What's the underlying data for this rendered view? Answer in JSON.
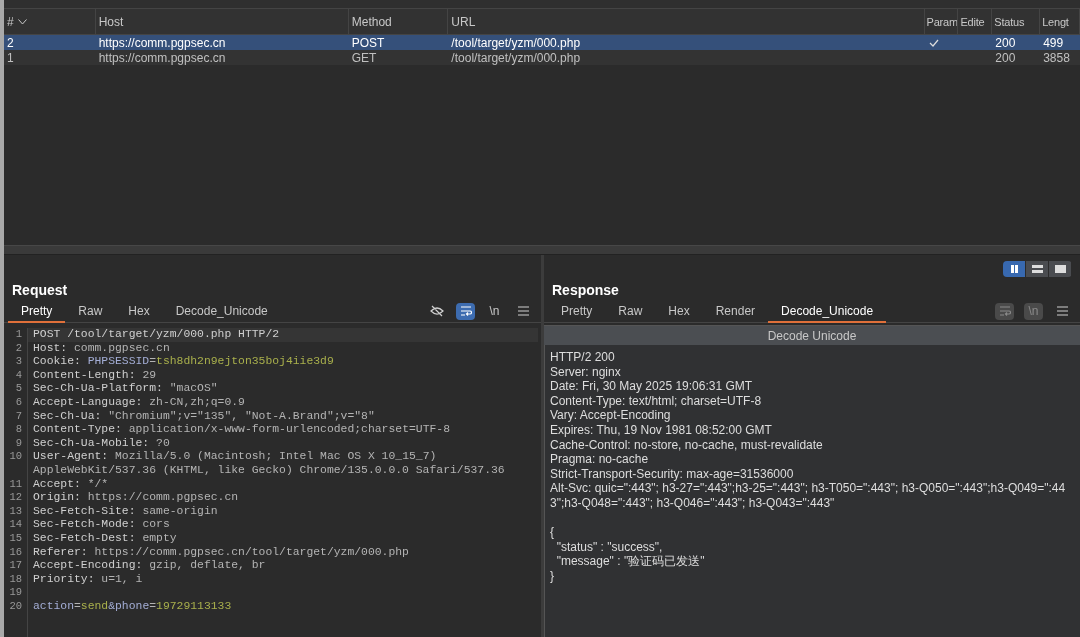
{
  "table": {
    "columns": [
      {
        "label": "#",
        "sorted": true
      },
      {
        "label": "Host",
        "sorted": false
      },
      {
        "label": "Method",
        "sorted": false
      },
      {
        "label": "URL",
        "sorted": false
      },
      {
        "label": "Param",
        "sorted": false
      },
      {
        "label": "Edite",
        "sorted": false
      },
      {
        "label": "Status",
        "sorted": false
      },
      {
        "label": "Lengt",
        "sorted": false
      }
    ],
    "rows": [
      {
        "number": "2",
        "host": "https://comm.pgpsec.cn",
        "method": "POST",
        "url": "/tool/target/yzm/000.php",
        "params": true,
        "status": "200",
        "length": "499",
        "selected": true
      },
      {
        "number": "1",
        "host": "https://comm.pgpsec.cn",
        "method": "GET",
        "url": "/tool/target/yzm/000.php",
        "params": false,
        "status": "200",
        "length": "3858",
        "selected": false
      }
    ]
  },
  "layout_modes": [
    {
      "kind": "columns",
      "selected": true
    },
    {
      "kind": "rows",
      "selected": false
    },
    {
      "kind": "single",
      "selected": false
    }
  ],
  "request": {
    "title": "Request",
    "tabs": [
      {
        "label": "Pretty",
        "selected": true
      },
      {
        "label": "Raw",
        "selected": false
      },
      {
        "label": "Hex",
        "selected": false
      },
      {
        "label": "Decode_Unicode",
        "selected": false
      }
    ],
    "tools": [
      {
        "kind": "hide",
        "on": false,
        "disabled": false
      },
      {
        "kind": "wrap",
        "on": true,
        "disabled": false
      },
      {
        "kind": "newline",
        "label": "\\n",
        "on": false,
        "disabled": false
      },
      {
        "kind": "menu"
      }
    ],
    "lines": [
      {
        "number": "1",
        "parts": [
          {
            "kind": "name",
            "text": "POST /tool/target/yzm/000.php HTTP/2"
          }
        ]
      },
      {
        "number": "2",
        "parts": [
          {
            "kind": "name",
            "text": "Host:"
          },
          {
            "kind": "value",
            "text": " comm.pgpsec.cn"
          }
        ]
      },
      {
        "number": "3",
        "parts": [
          {
            "kind": "name",
            "text": "Cookie: "
          },
          {
            "kind": "param",
            "text": "PHPSESSID"
          },
          {
            "kind": "value",
            "text": "="
          },
          {
            "kind": "param-value",
            "text": "tsh8dh2n9ejton35boj4iie3d9"
          }
        ]
      },
      {
        "number": "4",
        "parts": [
          {
            "kind": "name",
            "text": "Content-Length:"
          },
          {
            "kind": "value",
            "text": " 29"
          }
        ]
      },
      {
        "number": "5",
        "parts": [
          {
            "kind": "name",
            "text": "Sec-Ch-Ua-Platform:"
          },
          {
            "kind": "value",
            "text": " \"macOS\""
          }
        ]
      },
      {
        "number": "6",
        "parts": [
          {
            "kind": "name",
            "text": "Accept-Language:"
          },
          {
            "kind": "value",
            "text": " zh-CN,zh;q=0.9"
          }
        ]
      },
      {
        "number": "7",
        "parts": [
          {
            "kind": "name",
            "text": "Sec-Ch-Ua:"
          },
          {
            "kind": "value",
            "text": " \"Chromium\";v=\"135\", \"Not-A.Brand\";v=\"8\""
          }
        ]
      },
      {
        "number": "8",
        "parts": [
          {
            "kind": "name",
            "text": "Content-Type:"
          },
          {
            "kind": "value",
            "text": " application/x-www-form-urlencoded;charset=UTF-8"
          }
        ]
      },
      {
        "number": "9",
        "parts": [
          {
            "kind": "name",
            "text": "Sec-Ch-Ua-Mobile:"
          },
          {
            "kind": "value",
            "text": " ?0"
          }
        ]
      },
      {
        "number": "10",
        "parts": [
          {
            "kind": "name",
            "text": "User-Agent:"
          },
          {
            "kind": "value",
            "text": " Mozilla/5.0 (Macintosh; Intel Mac OS X 10_15_7) AppleWebKit/537.36 (KHTML, like Gecko) Chrome/135.0.0.0 Safari/537.36"
          }
        ]
      },
      {
        "number": "11",
        "parts": [
          {
            "kind": "name",
            "text": "Accept:"
          },
          {
            "kind": "value",
            "text": " */*"
          }
        ]
      },
      {
        "number": "12",
        "parts": [
          {
            "kind": "name",
            "text": "Origin:"
          },
          {
            "kind": "value",
            "text": " https://comm.pgpsec.cn"
          }
        ]
      },
      {
        "number": "13",
        "parts": [
          {
            "kind": "name",
            "text": "Sec-Fetch-Site:"
          },
          {
            "kind": "value",
            "text": " same-origin"
          }
        ]
      },
      {
        "number": "14",
        "parts": [
          {
            "kind": "name",
            "text": "Sec-Fetch-Mode:"
          },
          {
            "kind": "value",
            "text": " cors"
          }
        ]
      },
      {
        "number": "15",
        "parts": [
          {
            "kind": "name",
            "text": "Sec-Fetch-Dest:"
          },
          {
            "kind": "value",
            "text": " empty"
          }
        ]
      },
      {
        "number": "16",
        "parts": [
          {
            "kind": "name",
            "text": "Referer:"
          },
          {
            "kind": "value",
            "text": " https://comm.pgpsec.cn/tool/target/yzm/000.php"
          }
        ]
      },
      {
        "number": "17",
        "parts": [
          {
            "kind": "name",
            "text": "Accept-Encoding:"
          },
          {
            "kind": "value",
            "text": " gzip, deflate, br"
          }
        ]
      },
      {
        "number": "18",
        "parts": [
          {
            "kind": "name",
            "text": "Priority:"
          },
          {
            "kind": "value",
            "text": " u=1, i"
          }
        ]
      },
      {
        "number": "19"
      },
      {
        "number": "20",
        "parts": [
          {
            "kind": "param",
            "text": "action"
          },
          {
            "kind": "value",
            "text": "="
          },
          {
            "kind": "param-value",
            "text": "send"
          },
          {
            "kind": "param",
            "text": "&phone"
          },
          {
            "kind": "value",
            "text": "="
          },
          {
            "kind": "param-value",
            "text": "19729113133"
          }
        ]
      }
    ]
  },
  "response": {
    "title": "Response",
    "tabs": [
      {
        "label": "Pretty",
        "selected": false
      },
      {
        "label": "Raw",
        "selected": false
      },
      {
        "label": "Hex",
        "selected": false
      },
      {
        "label": "Render",
        "selected": false
      },
      {
        "label": "Decode_Unicode",
        "selected": true
      }
    ],
    "tools": [
      {
        "kind": "wrap",
        "on": false,
        "disabled": true
      },
      {
        "kind": "newline",
        "label": "\\n",
        "on": false,
        "disabled": true
      },
      {
        "kind": "menu"
      }
    ],
    "decoder_label": "Decode Unicode",
    "headers": [
      "HTTP/2 200",
      "Server: nginx",
      "Date: Fri, 30 May 2025 19:06:31 GMT",
      "Content-Type: text/html; charset=UTF-8",
      "Vary: Accept-Encoding",
      "Expires: Thu, 19 Nov 1981 08:52:00 GMT",
      "Cache-Control: no-store, no-cache, must-revalidate",
      "Pragma: no-cache",
      "Strict-Transport-Security: max-age=31536000",
      "Alt-Svc: quic=\":443\"; h3-27=\":443\";h3-25=\":443\"; h3-T050=\":443\"; h3-Q050=\":443\";h3-Q049=\":443\";h3-Q048=\":443\"; h3-Q046=\":443\"; h3-Q043=\":443\""
    ],
    "body": [
      "{",
      "  \"status\" : \"success\",",
      "  \"message\" : \"验证码已发送\"",
      "}"
    ]
  }
}
